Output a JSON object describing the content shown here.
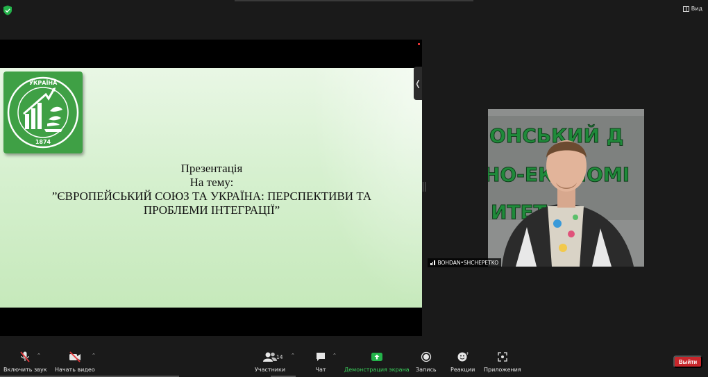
{
  "topbar": {
    "view_label": "Вид"
  },
  "slide": {
    "line1": "Презентація",
    "line2": "На тему:",
    "line3": "”ЄВРОПЕЙСЬКИЙ СОЮЗ ТА УКРАЇНА: ПЕРСПЕКТИВИ ТА",
    "line4": "ПРОБЛЕМИ ІНТЕГРАЦІЇ”",
    "logo_top": "УКРАЇНА",
    "logo_year": "1874"
  },
  "video": {
    "participant_name": "BOHDAN•SHCHEPETKO",
    "wall_text": [
      "ОНСЬКИЙ Д",
      "НО-ЕКОНОМІ",
      "ИТЕТ"
    ]
  },
  "toolbar": {
    "mute": "Включить звук",
    "video": "Начать видео",
    "participants": "Участники",
    "participants_count": "14",
    "chat": "Чат",
    "share": "Демонстрация экрана",
    "record": "Запись",
    "reactions": "Реакции",
    "apps": "Приложения",
    "leave": "Выйти"
  },
  "colors": {
    "accent_green": "#3bd15c",
    "leave_red": "#c8262b",
    "logo_green": "#3fa045"
  }
}
